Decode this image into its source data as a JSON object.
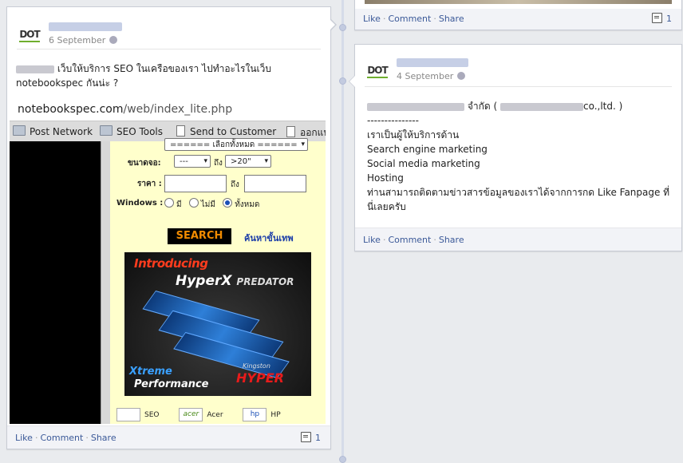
{
  "colors": {
    "link": "#3b5998",
    "background": "#e9ebee",
    "logo_accent": "#6fae2e"
  },
  "actions": {
    "like": "Like",
    "comment": "Comment",
    "share": "Share"
  },
  "top_right_card": {
    "share_count": "1"
  },
  "left_post": {
    "logo_text": "DOT",
    "date": "6 September",
    "text_line1": "เว็บให้บริการ SEO ในเครือของเรา ไปทำอะไรในเว็บ",
    "text_line2": "notebookspec กันน่ะ ?",
    "share_count": "1",
    "screenshot": {
      "url_domain": "notebookspec.com",
      "url_path": "/web/index_lite.php",
      "bookmarks": [
        "Post Network",
        "SEO Tools",
        "Send to Customer",
        "ออกแบ"
      ],
      "form": {
        "select_top": "====== เลือกทั้งหมด ======",
        "size_label": "ขนาดจอ:",
        "size_from": "---",
        "to_word": "ถึง",
        "size_to": ">20\"",
        "price_label": "ราคา :",
        "windows_label": "Windows :",
        "opt_yes": "มี",
        "opt_no": "ไม่มี",
        "opt_all": "ทั้งหมด",
        "search_button": "SEARCH",
        "advanced_link": "ค้นหาขั้นเทพ"
      },
      "ad": {
        "introducing": "Introducing",
        "hyperx": "HyperX",
        "predator": "PREDATOR",
        "xtreme": "Xtreme",
        "performance": "Performance",
        "kingston": "Kingston",
        "hyper": "HYPER"
      },
      "brands": [
        "SEO",
        "Acer",
        "HP"
      ],
      "brand_logos": [
        "acer",
        "hp"
      ]
    }
  },
  "right_post": {
    "logo_text": "DOT",
    "date": "4 September",
    "company_suffix_th": "จำกัด (",
    "company_suffix_en": "co.,ltd. )",
    "divider_text": "---------------",
    "lines": [
      "เราเป็นผู้ให้บริการด้าน",
      "Search engine marketing",
      "Social media marketing",
      "Hosting",
      "ท่านสามารถติดตามข่าวสารข้อมูลของเราได้จากการกด Like Fanpage ที่",
      "นี่เลยครับ"
    ]
  }
}
